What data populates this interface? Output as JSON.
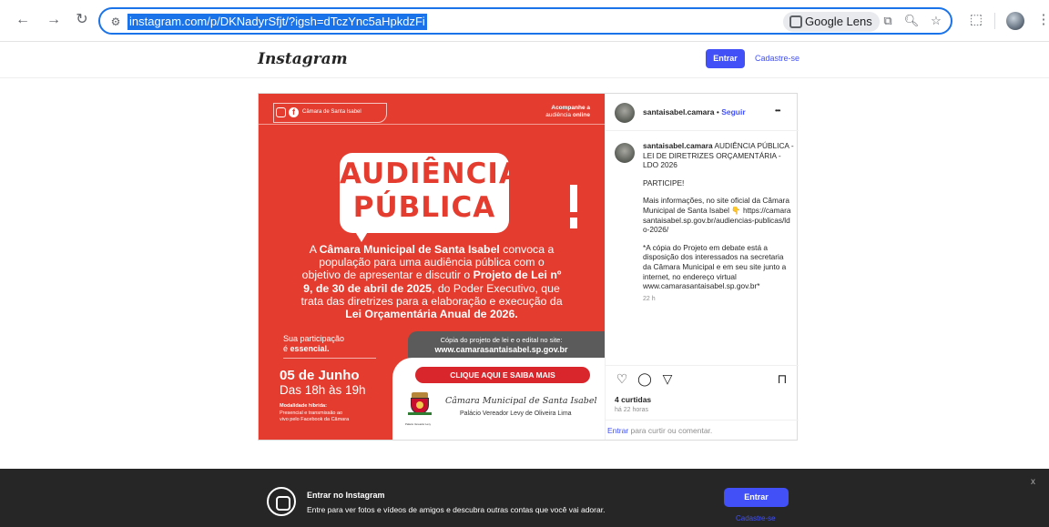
{
  "browser": {
    "url": "instagram.com/p/DKNadyrSfjt/?igsh=dTczYnc5aHpkdzFi",
    "lens_label": "Google Lens",
    "icons": [
      "back-arrow-icon",
      "forward-arrow-icon",
      "reload-icon",
      "site-info-icon",
      "lens-icon",
      "install-icon",
      "zoom-icon",
      "star-icon",
      "extensions-icon",
      "profile-icon",
      "menu-icon"
    ]
  },
  "header": {
    "logo": "Instagram",
    "login_label": "Entrar",
    "signup_label": "Cadastre-se"
  },
  "post": {
    "image": {
      "chamber_name": "Câmara de Santa Isabel",
      "follow_line1": "Acompanhe a",
      "follow_line2a": "audiência ",
      "follow_line2b": "online",
      "headline1": "AUDIÊNCIA",
      "headline2": "PÚBLICA",
      "body_line1a": "A ",
      "body_line1b": "Câmara Municipal de Santa Isabel",
      "body_line1c": " convoca a",
      "body_line2": "população para uma audiência pública com o",
      "body_line3a": "objetivo de apresentar e discutir o ",
      "body_line3b": "Projeto de Lei nº",
      "body_line4a": "9, de 30 de abril de 2025",
      "body_line4b": ", do Poder Executivo, que",
      "body_line5": "trata das diretrizes para a elaboração e execução da",
      "body_line6": "Lei Orçamentária Anual de 2026.",
      "participation1": "Sua participação",
      "participation2a": "é ",
      "participation2b": "essencial.",
      "copy_note": "Cópia do projeto de lei e o edital no site:",
      "copy_site": "www.camarasantaisabel.sp.gov.br",
      "date": "05 de Junho",
      "hours": "Das 18h às 19h",
      "modality_title": "Modalidade híbrida:",
      "modality_line1": "Presencial e transmissão ao",
      "modality_line2": "vivo pelo Facebook da Câmara",
      "cta": "CLIQUE AQUI  E SAIBA MAIS",
      "footer_name": "Câmara Municipal de Santa Isabel",
      "footer_palace": "Palácio Vereador Levy de Oliveira Lima",
      "crest_caption": "Palácio Vereador Levy"
    },
    "side": {
      "username": "santaisabel.camara",
      "separator": "•",
      "follow": "Seguir",
      "more": "•••",
      "caption_title": "AUDIÊNCIA PÚBLICA - LEI DE DIRETRIZES ORÇAMENTÁRIA - LDO 2026",
      "caption_p1": "PARTICIPE!",
      "caption_p2": "Mais informações, no site oficial da Câmara Municipal de Santa Isabel 👇 https://camarasantaisabel.sp.gov.br/audiencias-publicas/ldo-2026/",
      "caption_p3": "*A cópia do Projeto em debate está a disposição dos interessados na secretaria da Câmara Municipal e em seu site junto a internet, no endereço virtual www.camarasantaisabel.sp.gov.br*",
      "caption_time": "22 h",
      "likes": "4 curtidas",
      "time": "há 22 horas",
      "comment_link": "Entrar",
      "comment_text": " para curtir ou comentar."
    }
  },
  "banner": {
    "title": "Entrar no Instagram",
    "subtitle": "Entre para ver fotos e vídeos de amigos e descubra outras contas que você vai adorar.",
    "login_label": "Entrar",
    "signup_label": "Cadastre-se",
    "close": "x"
  },
  "colors": {
    "accent": "#4150f7",
    "poster_red": "#e43c2f",
    "poster_gray": "#5b5b5b",
    "cta_red": "#d9262c"
  }
}
